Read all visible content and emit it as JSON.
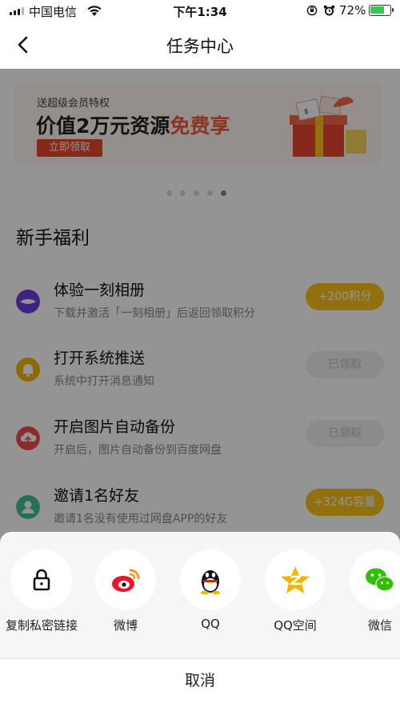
{
  "status_bar": {
    "carrier": "中国电信",
    "time": "下午1:34",
    "battery": "72%"
  },
  "nav": {
    "title": "任务中心"
  },
  "banner": {
    "small_text": "送超级会员特权",
    "headline_prefix": "价值2万元资源",
    "headline_highlight": "免费享",
    "button_label": "立即领取"
  },
  "carousel": {
    "count": 5,
    "active_index": 4
  },
  "section": {
    "title": "新手福利"
  },
  "tasks": [
    {
      "name": "体验一刻相册",
      "desc": "下载并激活「一刻相册」后返回领取积分",
      "action": "+200积分",
      "state": "active",
      "icon": "moment-album-icon",
      "color": "#6b3fd9"
    },
    {
      "name": "打开系统推送",
      "desc": "系统中打开消息通知",
      "action": "已领取",
      "state": "done",
      "icon": "bell-icon",
      "color": "#f5b400"
    },
    {
      "name": "开启图片自动备份",
      "desc": "开启后，图片自动备份到百度网盘",
      "action": "已领取",
      "state": "done",
      "icon": "cloud-upload-icon",
      "color": "#f24e4e"
    },
    {
      "name": "邀请1名好友",
      "desc": "邀请1名没有使用过网盘APP的好友",
      "action": "+324G容量",
      "state": "active",
      "icon": "user-icon",
      "color": "#3cc48f"
    }
  ],
  "share_sheet": {
    "options": [
      {
        "label": "复制私密链接",
        "icon": "lock-icon"
      },
      {
        "label": "微博",
        "icon": "weibo-icon"
      },
      {
        "label": "QQ",
        "icon": "qq-icon"
      },
      {
        "label": "QQ空间",
        "icon": "qzone-icon"
      },
      {
        "label": "微信",
        "icon": "wechat-icon"
      }
    ],
    "cancel_label": "取消"
  }
}
